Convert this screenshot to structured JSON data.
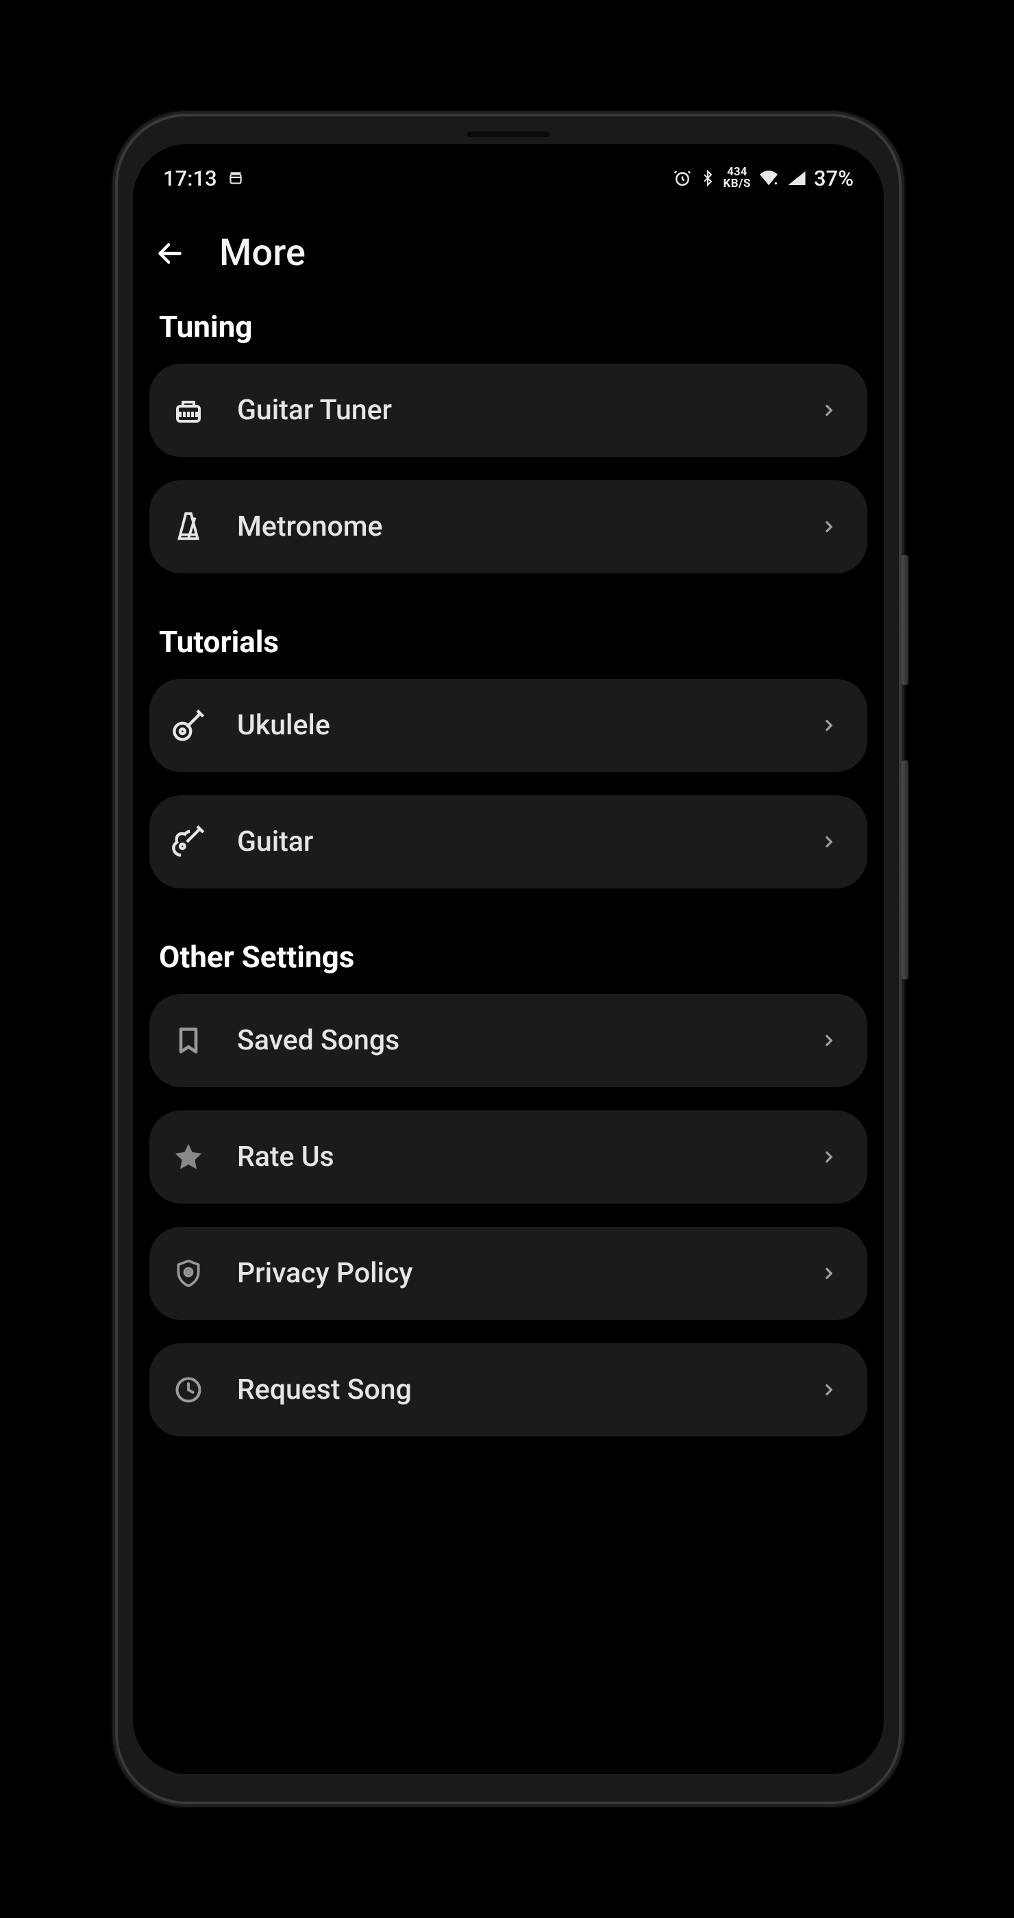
{
  "status": {
    "time": "17:13",
    "net_rate": "434",
    "net_unit": "KB/S",
    "battery": "37%"
  },
  "header": {
    "title": "More"
  },
  "sections": [
    {
      "title": "Tuning",
      "items": [
        {
          "id": "guitar-tuner",
          "label": "Guitar Tuner",
          "icon": "tuner-icon"
        },
        {
          "id": "metronome",
          "label": "Metronome",
          "icon": "metronome-icon"
        }
      ]
    },
    {
      "title": "Tutorials",
      "items": [
        {
          "id": "ukulele",
          "label": "Ukulele",
          "icon": "ukulele-icon"
        },
        {
          "id": "guitar",
          "label": "Guitar",
          "icon": "guitar-icon"
        }
      ]
    },
    {
      "title": "Other Settings",
      "items": [
        {
          "id": "saved-songs",
          "label": "Saved Songs",
          "icon": "bookmark-icon"
        },
        {
          "id": "rate-us",
          "label": "Rate Us",
          "icon": "star-icon"
        },
        {
          "id": "privacy-policy",
          "label": "Privacy Policy",
          "icon": "shield-icon"
        },
        {
          "id": "request-song",
          "label": "Request Song",
          "icon": "clock-icon"
        }
      ]
    }
  ]
}
